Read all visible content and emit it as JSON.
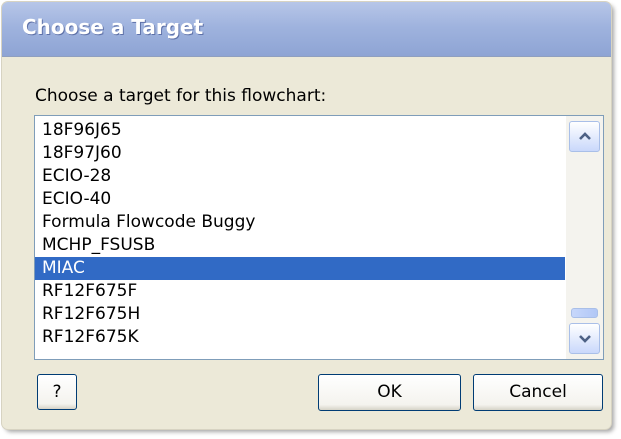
{
  "window": {
    "title": "Choose a Target"
  },
  "prompt": "Choose a target for this flowchart:",
  "list": {
    "items": [
      "18F96J65",
      "18F97J60",
      "ECIO-28",
      "ECIO-40",
      "Formula Flowcode Buggy",
      "MCHP_FSUSB",
      "MIAC",
      "RF12F675F",
      "RF12F675H",
      "RF12F675K"
    ],
    "selected": "MIAC"
  },
  "buttons": {
    "help": "?",
    "ok": "OK",
    "cancel": "Cancel"
  },
  "colors": {
    "selection": "#316ac5",
    "dialog_bg": "#ece9d8",
    "title_text": "#ffffff"
  },
  "icons": {
    "scroll_up": "chevron-up-icon",
    "scroll_down": "chevron-down-icon"
  }
}
